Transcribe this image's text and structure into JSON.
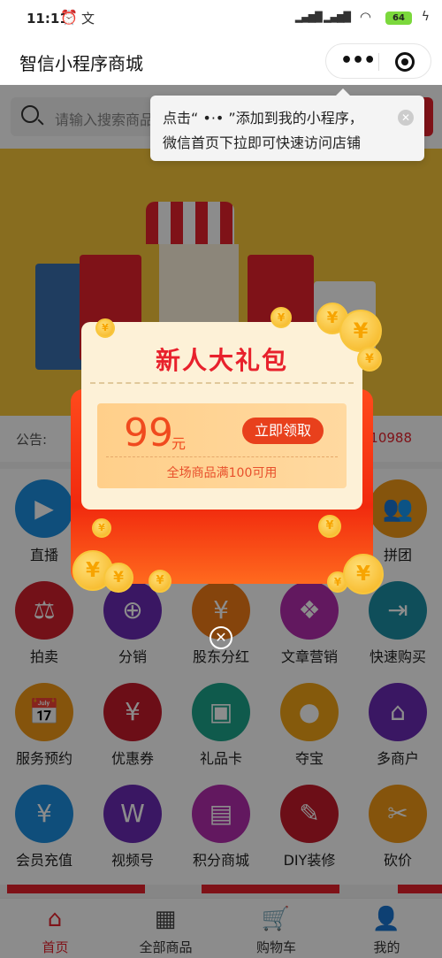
{
  "status": {
    "time": "11:11",
    "alarm_icon": "alarm-clock-icon",
    "ime_icon": "文",
    "battery": "64"
  },
  "nav": {
    "title": "智信小程序商城",
    "more_icon": "more-dots-icon",
    "close_icon": "capsule-close-icon"
  },
  "search": {
    "placeholder": "请输入搜索商品"
  },
  "tooltip": {
    "line1": "点击“ •·• ”添加到我的小程序，",
    "line2": "微信首页下拉即可快速访问店铺"
  },
  "notice": {
    "label": "公告:",
    "number": "10988"
  },
  "grid": [
    {
      "label": "直播",
      "icon": "▶",
      "color": "#1d8fe0"
    },
    {
      "label": "",
      "icon": "",
      "color": "#a0a0a0"
    },
    {
      "label": "",
      "icon": "",
      "color": "#a0a0a0"
    },
    {
      "label": "",
      "icon": "",
      "color": "#a0a0a0"
    },
    {
      "label": "拼团",
      "icon": "👥",
      "color": "#f29a17"
    },
    {
      "label": "拍卖",
      "icon": "⚖",
      "color": "#d21f2c"
    },
    {
      "label": "分销",
      "icon": "⊕",
      "color": "#6a2bb5"
    },
    {
      "label": "股东分红",
      "icon": "¥",
      "color": "#f27c17"
    },
    {
      "label": "文章营销",
      "icon": "❖",
      "color": "#b32cae"
    },
    {
      "label": "快速购买",
      "icon": "⇥",
      "color": "#1d8fa5"
    },
    {
      "label": "服务预约",
      "icon": "📅",
      "color": "#f29a17"
    },
    {
      "label": "优惠券",
      "icon": "¥",
      "color": "#c51a2a"
    },
    {
      "label": "礼品卡",
      "icon": "▣",
      "color": "#1da58a"
    },
    {
      "label": "夺宝",
      "icon": "●",
      "color": "#f2a517"
    },
    {
      "label": "多商户",
      "icon": "⌂",
      "color": "#6a2bb5"
    },
    {
      "label": "会员充值",
      "icon": "¥",
      "color": "#1d8fe0"
    },
    {
      "label": "视频号",
      "icon": "W",
      "color": "#6a2bb5"
    },
    {
      "label": "积分商城",
      "icon": "▤",
      "color": "#b32cae"
    },
    {
      "label": "DIY装修",
      "icon": "✎",
      "color": "#c51a2a"
    },
    {
      "label": "砍价",
      "icon": "✂",
      "color": "#f29a17"
    }
  ],
  "tabs": [
    {
      "label": "首页",
      "icon": "⌂",
      "active": true
    },
    {
      "label": "全部商品",
      "icon": "▦",
      "active": false
    },
    {
      "label": "购物车",
      "icon": "🛒",
      "active": false
    },
    {
      "label": "我的",
      "icon": "👤",
      "active": false
    }
  ],
  "modal": {
    "title": "新人大礼包",
    "price": "99",
    "unit": "元",
    "claim_label": "立即领取",
    "condition": "全场商品满100可用",
    "coin_glyph": "¥",
    "close_glyph": "✕"
  },
  "colors": {
    "accent": "#e8212c",
    "banner": "#f7c63a",
    "coupon": "#ffcf8a"
  }
}
